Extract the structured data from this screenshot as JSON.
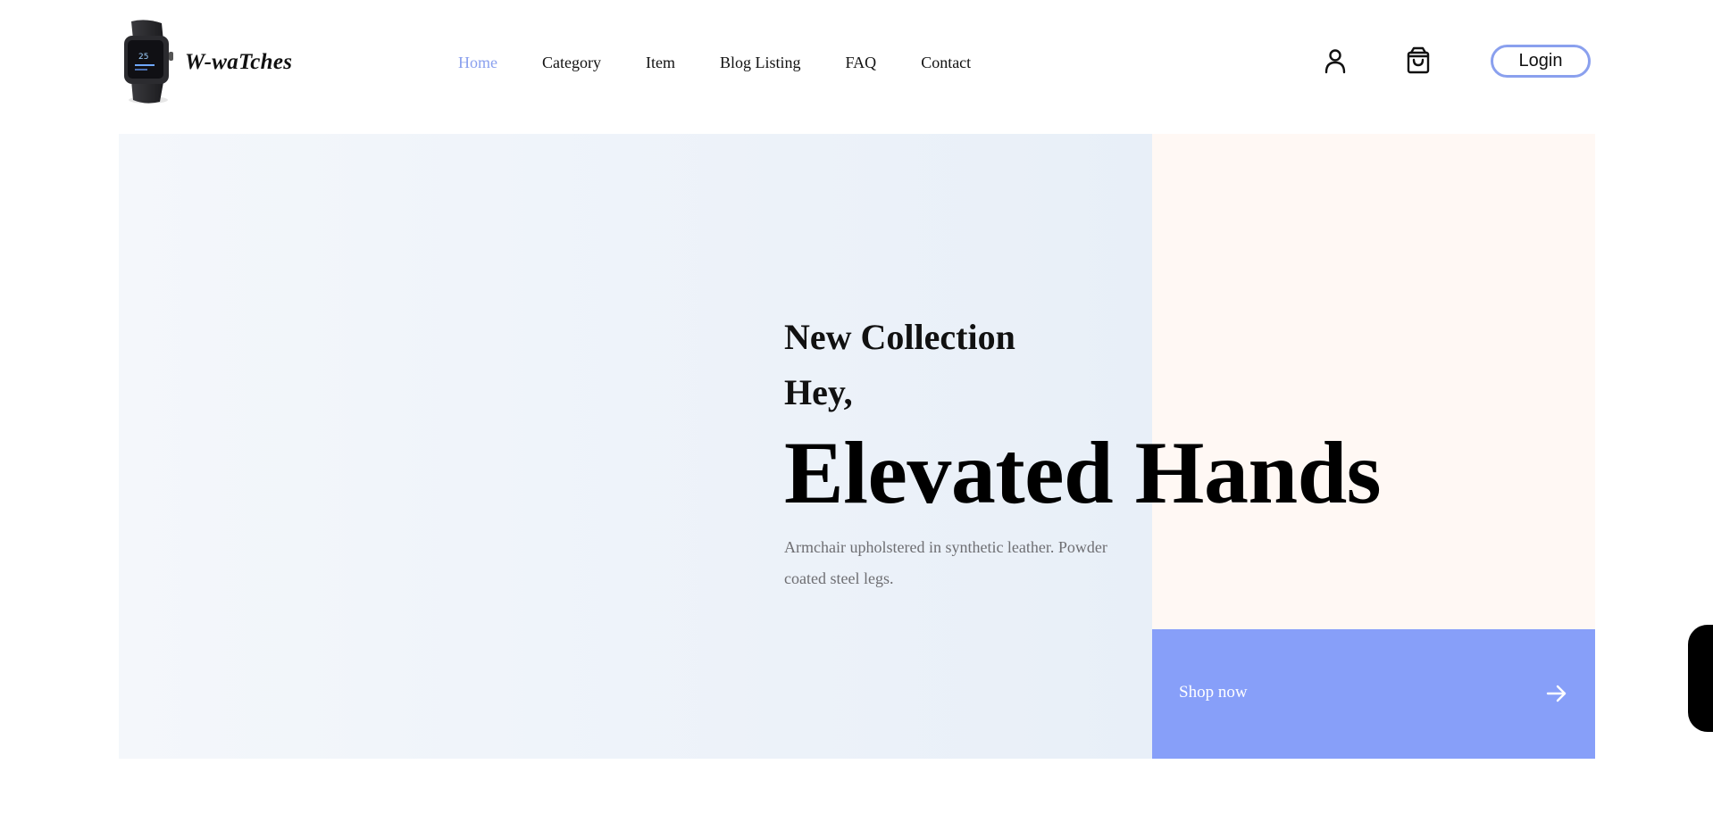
{
  "brand": {
    "name": "W-waTches",
    "logo_icon": "smartwatch-logo-icon"
  },
  "nav": {
    "items": [
      {
        "label": "Home",
        "active": true
      },
      {
        "label": "Category",
        "active": false
      },
      {
        "label": "Item",
        "active": false
      },
      {
        "label": "Blog Listing",
        "active": false
      },
      {
        "label": "FAQ",
        "active": false
      },
      {
        "label": "Contact",
        "active": false
      }
    ]
  },
  "header": {
    "user_icon": "user-icon",
    "cart_icon": "shopping-bag-icon",
    "login_label": "Login"
  },
  "hero": {
    "eyebrow": "New Collection",
    "greeting": "Hey,",
    "headline": "Elevated Hands",
    "description": "Armchair upholstered in synthetic leather. Powder coated steel legs.",
    "cta_label": "Shop now",
    "cta_icon": "arrow-right-icon"
  },
  "colors": {
    "accent": "#879ff9",
    "nav_active": "#8aa0ee",
    "hero_left_bg": "#eaf0f8",
    "hero_right_bg": "#fff8f4",
    "text_primary": "#111111",
    "text_muted": "#6e6e72"
  }
}
